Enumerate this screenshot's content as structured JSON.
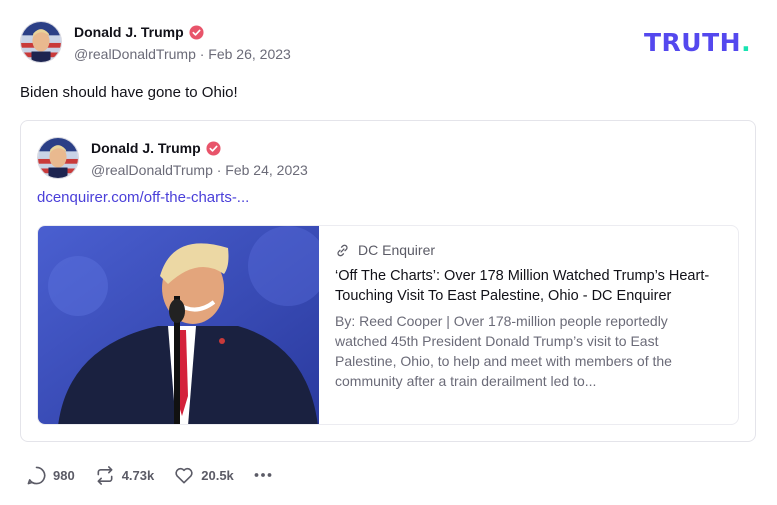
{
  "post": {
    "author_name": "Donald J. Trump",
    "handle_date": "@realDonaldTrump · Feb 26, 2023",
    "text": "Biden should have gone to Ohio!"
  },
  "brand": {
    "logo_main": "TRUTH",
    "logo_dot": "."
  },
  "quoted": {
    "author_name": "Donald J. Trump",
    "handle_date": "@realDonaldTrump · Feb 24, 2023",
    "link_text": "dcenquirer.com/off-the-charts-...",
    "card": {
      "source": "DC Enquirer",
      "title": "‘Off The Charts’: Over 178 Million Watched Trump’s Heart-Touching Visit To East Palestine, Ohio - DC Enquirer",
      "description": "By: Reed Cooper | Over 178-million people reportedly watched 45th President Donald Trump’s visit to East Palestine, Ohio, to help and meet with members of the community after a train derailment led to..."
    }
  },
  "actions": {
    "replies": "980",
    "retruths": "4.73k",
    "likes": "20.5k"
  },
  "icons": [
    "verified-badge-icon",
    "link-icon",
    "reply-icon",
    "retruth-icon",
    "like-icon",
    "more-icon"
  ],
  "colors": {
    "brand": "#5448ee",
    "brand_dot": "#17e3b1",
    "link": "#4a3fd9",
    "verified": "#e8546a"
  }
}
